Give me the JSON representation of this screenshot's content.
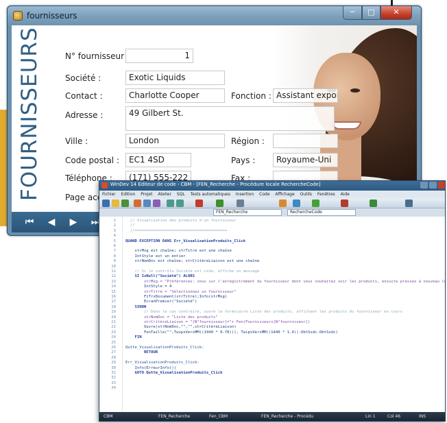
{
  "fournisseurs_window": {
    "title": "fournisseurs",
    "vertical_title": "FOURNISSEURS",
    "fields": {
      "numero": {
        "label": "N° fournisseur",
        "value": "1"
      },
      "societe": {
        "label": "Société :",
        "value": "Exotic Liquids"
      },
      "contact": {
        "label": "Contact :",
        "value": "Charlotte Cooper"
      },
      "fonction": {
        "label": "Fonction :",
        "value": "Assistant export"
      },
      "adresse": {
        "label": "Adresse :",
        "value": "49 Gilbert St."
      },
      "ville": {
        "label": "Ville :",
        "value": "London"
      },
      "region": {
        "label": "Région :",
        "value": ""
      },
      "code_postal": {
        "label": "Code postal :",
        "value": "EC1 4SD"
      },
      "pays": {
        "label": "Pays :",
        "value": "Royaume-Uni"
      },
      "telephone": {
        "label": "Téléphone :",
        "value": "(171) 555-222"
      },
      "fax": {
        "label": "Fax :",
        "value": ""
      },
      "page_accueil": {
        "label": "Page accu"
      }
    },
    "nav": {
      "first": "⏮",
      "prev": "◀",
      "next": "▶",
      "last": "⏭"
    },
    "window_controls": {
      "min": "─",
      "max": "□",
      "close": "✕"
    }
  },
  "code_window": {
    "title": "WinDev 14 Editeur de code - CBM - [FEN_Recherche - Procédure locale RechercheCode]",
    "menu": [
      "Fichier",
      "Edition",
      "Projet",
      "Atelier",
      "SQL",
      "Tests automatiques",
      "Insertion",
      "Code",
      "Affichage",
      "Outils",
      "Fenêtres",
      "Aide"
    ],
    "tabs": [
      "FEN_Recherche",
      "RechercheCode"
    ],
    "line_numbers": [
      "1",
      "2",
      "3",
      "4",
      "5",
      "6",
      "7",
      "8",
      "9",
      "10",
      "11",
      "12",
      "13",
      "14",
      "15",
      "16",
      "17",
      "18",
      "19",
      "20",
      "21",
      "22",
      "23",
      "24",
      "25",
      "26",
      "27",
      "28",
      "29",
      "30",
      "31",
      "32",
      "33",
      "34"
    ],
    "code_lines": [
      {
        "t": "comment",
        "s": "  // Visualisation des produits d'un fournisseur"
      },
      {
        "t": "comment",
        "s": "  //"
      },
      {
        "t": "comment",
        "s": "  //========================================"
      },
      {
        "t": "code",
        "s": ""
      },
      {
        "t": "kw",
        "s": "QUAND EXCEPTION DANS Err_VisualisationProduits_Click"
      },
      {
        "t": "code",
        "s": ""
      },
      {
        "t": "code",
        "s": "    strMsg est chaîne; strTitre est une chaîne"
      },
      {
        "t": "code",
        "s": "    IntStyle est un entier"
      },
      {
        "t": "code",
        "s": "    strNomDoc est chaîne; strCritèreLiaison est une chaîne"
      },
      {
        "t": "code",
        "s": ""
      },
      {
        "t": "comment",
        "s": "    // Si le contrôle Société est vide, affiche un message"
      },
      {
        "t": "kw",
        "s": "    SI IsNull(\"Société\") ALORS"
      },
      {
        "t": "str",
        "s": "        strMsg = \"Préférences: vous sur l'enregistrement du fournisseur dont vous souhaitez voir les produits, ensuite pressez à nouveau le bouton Visualisation produits\""
      },
      {
        "t": "code",
        "s": "        IntStyle = 4"
      },
      {
        "t": "str",
        "s": "        strTitre = \"Sélectionnez un fournisseur\""
      },
      {
        "t": "code",
        "s": "        FiTrsDocument(strTitre);Info(strMsg)"
      },
      {
        "t": "code",
        "s": "        EcranPremier(\"Société\")"
      },
      {
        "t": "kw",
        "s": "    SINON"
      },
      {
        "t": "comment",
        "s": "        // Dans le cas contraire, ouvre le formulaire Liste des produits, affichant les produits du fournisseur en cours"
      },
      {
        "t": "str",
        "s": "        strNomDoc = \"Liste des produits\""
      },
      {
        "t": "str",
        "s": "        strCritèreLiaison = \"[N°fournisseur]=\"+ Fen(Fournisseurs[N°fournisseur])"
      },
      {
        "t": "code",
        "s": "        Ouvre(strNomDoc,\"\",\"\",strCritèreLiaison)"
      },
      {
        "t": "code",
        "s": "        FenTaille(\"\",TwipsVersMM((1440 * 0.78))), TwipsVersMM((1440 * 1.4)).ObtSsdc.ObtSsdc)"
      },
      {
        "t": "kw",
        "s": "    FIN"
      },
      {
        "t": "code",
        "s": ""
      },
      {
        "t": "label",
        "s": "Qutte_VisualisationProduits_Click:"
      },
      {
        "t": "kw",
        "s": "        RETOUR"
      },
      {
        "t": "code",
        "s": ""
      },
      {
        "t": "label",
        "s": "Err_VisualisationProduits_Click:"
      },
      {
        "t": "code",
        "s": "    Info(ErreurInfo())"
      },
      {
        "t": "kw",
        "s": "    GOTO Qutte_VisualisationProduits_Click"
      },
      {
        "t": "code",
        "s": ""
      },
      {
        "t": "code",
        "s": ""
      },
      {
        "t": "code",
        "s": ""
      }
    ],
    "status": [
      "CBM",
      "FEN_Recherche",
      "Fen_CBM",
      "FEN_Recherche - Procédu"
    ],
    "status_right": [
      "Lin 1",
      "Col 46",
      "INS"
    ]
  },
  "colors": {
    "brand_blue": "#2f5f85",
    "accent_yellow": "#e8b73c",
    "titlebar_blue": "#3f6d96",
    "close_red": "#c6402b"
  }
}
